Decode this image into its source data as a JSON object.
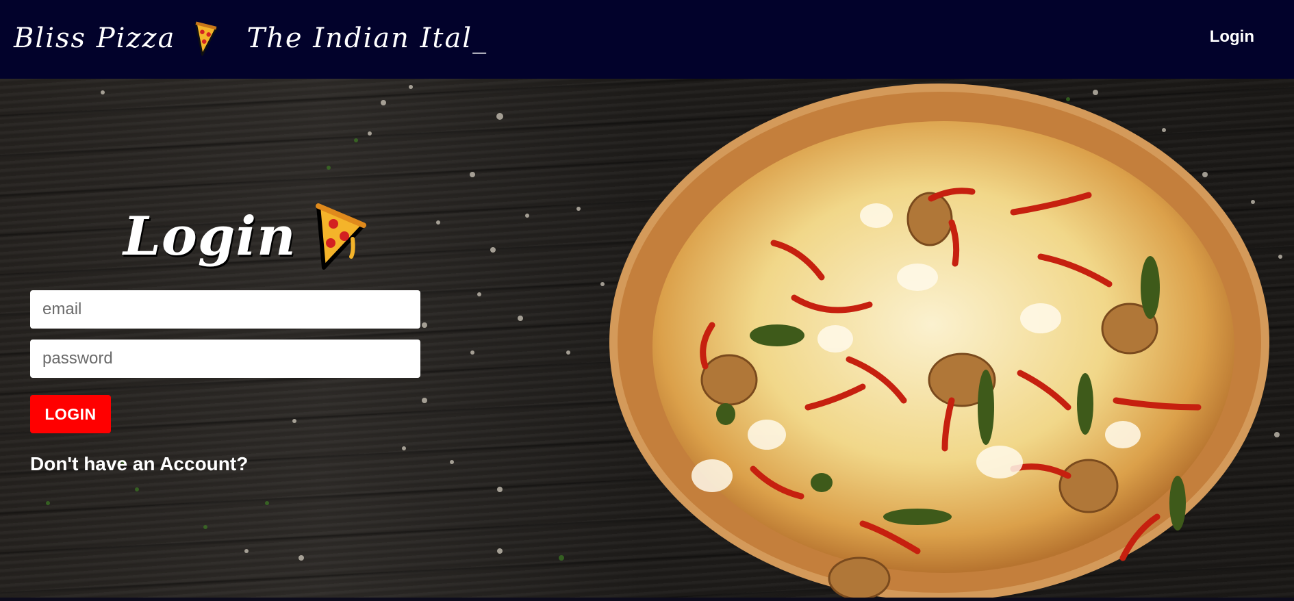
{
  "navbar": {
    "brand_name": "Bliss Pizza",
    "tagline": "The Indian Ital_",
    "brand_icon": "pizza-slice-icon",
    "login_link": "Login"
  },
  "login_form": {
    "title": "Login",
    "title_icon": "pizza-slice-icon",
    "email_placeholder": "email",
    "password_placeholder": "password",
    "submit_label": "LOGIN",
    "signup_prompt": "Don't have an Account?"
  },
  "colors": {
    "navbar_bg": "#02022b",
    "button_bg": "#ff0000",
    "text": "#ffffff"
  }
}
